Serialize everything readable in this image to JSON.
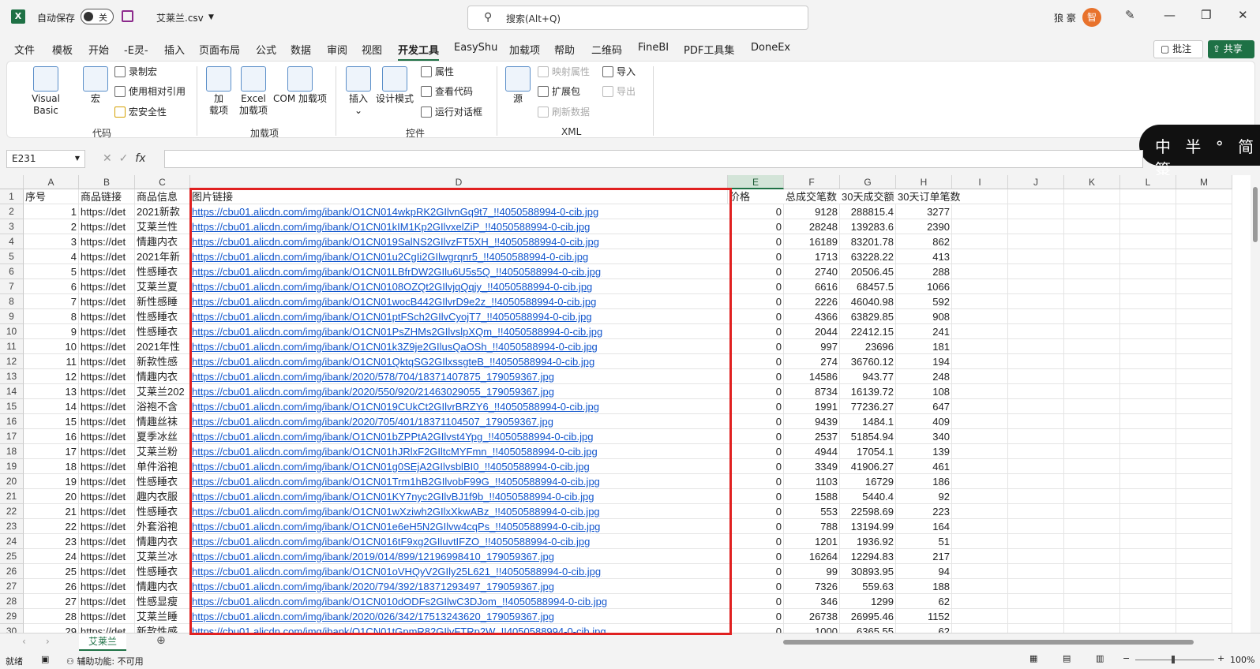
{
  "titlebar": {
    "autosave_label": "自动保存",
    "autosave_state": "关",
    "filename": "艾莱兰.csv",
    "search_placeholder": "搜索(Alt+Q)",
    "user_name": "狼 豪",
    "avatar_text": "智"
  },
  "menu": [
    "文件",
    "模板",
    "开始",
    "-E灵-",
    "插入",
    "页面布局",
    "公式",
    "数据",
    "审阅",
    "视图",
    "开发工具",
    "EasyShu",
    "加载项",
    "帮助",
    "二维码",
    "FineBI",
    "PDF工具集",
    "DoneEx"
  ],
  "menu_active": "开发工具",
  "actions": {
    "comment": "批注",
    "share": "共享"
  },
  "ribbon": {
    "code": {
      "label": "代码",
      "visual_basic": "Visual Basic",
      "macro": "宏",
      "record_macro": "录制宏",
      "relative_ref": "使用相对引用",
      "macro_security": "宏安全性"
    },
    "addins": {
      "label": "加载项",
      "add": "加\n载项",
      "excel_addins": "Excel\n加载项",
      "com_addins": "COM 加载项"
    },
    "controls": {
      "label": "控件",
      "insert": "插入",
      "design_mode": "设计模式",
      "properties": "属性",
      "view_code": "查看代码",
      "run_dialog": "运行对话框"
    },
    "xml": {
      "label": "XML",
      "source": "源",
      "map_properties": "映射属性",
      "expansion_packs": "扩展包",
      "refresh_data": "刷新数据",
      "import": "导入",
      "export": "导出"
    }
  },
  "watermark": "中 半 ° 简 箓",
  "formula_bar": {
    "name_box": "E231",
    "fx": "fx",
    "value": ""
  },
  "columns": [
    "A",
    "B",
    "C",
    "D",
    "E",
    "F",
    "G",
    "H",
    "I",
    "J",
    "K",
    "L",
    "M"
  ],
  "selected_column": "E",
  "headers": [
    "序号",
    "商品链接",
    "商品信息",
    "图片链接",
    "价格",
    "总成交笔数",
    "30天成交额",
    "30天订单笔数"
  ],
  "rows": [
    [
      "1",
      "https://det",
      "2021新款",
      "https://cbu01.alicdn.com/img/ibank/O1CN014wkpRK2GIlvnGq9t7_!!4050588994-0-cib.jpg",
      "0",
      "9128",
      "288815.4",
      "3277"
    ],
    [
      "2",
      "https://det",
      "艾莱兰性",
      "https://cbu01.alicdn.com/img/ibank/O1CN01kIM1Kp2GIlvxelZiP_!!4050588994-0-cib.jpg",
      "0",
      "28248",
      "139283.6",
      "2390"
    ],
    [
      "3",
      "https://det",
      "情趣内衣",
      "https://cbu01.alicdn.com/img/ibank/O1CN019SalNS2GIlvzFT5XH_!!4050588994-0-cib.jpg",
      "0",
      "16189",
      "83201.78",
      "862"
    ],
    [
      "4",
      "https://det",
      "2021年新",
      "https://cbu01.alicdn.com/img/ibank/O1CN01u2CgIi2GIlwgrqnr5_!!4050588994-0-cib.jpg",
      "0",
      "1713",
      "63228.22",
      "413"
    ],
    [
      "5",
      "https://det",
      "性感睡衣",
      "https://cbu01.alicdn.com/img/ibank/O1CN01LBfrDW2GIlu6U5s5Q_!!4050588994-0-cib.jpg",
      "0",
      "2740",
      "20506.45",
      "288"
    ],
    [
      "6",
      "https://det",
      "艾莱兰夏",
      "https://cbu01.alicdn.com/img/ibank/O1CN0108OZQt2GIlvjqQqjy_!!4050588994-0-cib.jpg",
      "0",
      "6616",
      "68457.5",
      "1066"
    ],
    [
      "7",
      "https://det",
      "新性感睡",
      "https://cbu01.alicdn.com/img/ibank/O1CN01wocB442GIlvrD9e2z_!!4050588994-0-cib.jpg",
      "0",
      "2226",
      "46040.98",
      "592"
    ],
    [
      "8",
      "https://det",
      "性感睡衣",
      "https://cbu01.alicdn.com/img/ibank/O1CN01ptFSch2GIlvCyojT7_!!4050588994-0-cib.jpg",
      "0",
      "4366",
      "63829.85",
      "908"
    ],
    [
      "9",
      "https://det",
      "性感睡衣",
      "https://cbu01.alicdn.com/img/ibank/O1CN01PsZHMs2GIlvslpXQm_!!4050588994-0-cib.jpg",
      "0",
      "2044",
      "22412.15",
      "241"
    ],
    [
      "10",
      "https://det",
      "2021年性",
      "https://cbu01.alicdn.com/img/ibank/O1CN01k3Z9je2GIlusQaOSh_!!4050588994-0-cib.jpg",
      "0",
      "997",
      "23696",
      "181"
    ],
    [
      "11",
      "https://det",
      "新款性感",
      "https://cbu01.alicdn.com/img/ibank/O1CN01QktqSG2GIlxssgteB_!!4050588994-0-cib.jpg",
      "0",
      "274",
      "36760.12",
      "194"
    ],
    [
      "12",
      "https://det",
      "情趣内衣",
      "https://cbu01.alicdn.com/img/ibank/2020/578/704/18371407875_179059367.jpg",
      "0",
      "14586",
      "943.77",
      "248"
    ],
    [
      "13",
      "https://det",
      "艾莱兰202",
      "https://cbu01.alicdn.com/img/ibank/2020/550/920/21463029055_179059367.jpg",
      "0",
      "8734",
      "16139.72",
      "108"
    ],
    [
      "14",
      "https://det",
      "浴袍不含",
      "https://cbu01.alicdn.com/img/ibank/O1CN019CUkCt2GIlvrBRZY6_!!4050588994-0-cib.jpg",
      "0",
      "1991",
      "77236.27",
      "647"
    ],
    [
      "15",
      "https://det",
      "情趣丝袜",
      "https://cbu01.alicdn.com/img/ibank/2020/705/401/18371104507_179059367.jpg",
      "0",
      "9439",
      "1484.1",
      "409"
    ],
    [
      "16",
      "https://det",
      "夏季冰丝",
      "https://cbu01.alicdn.com/img/ibank/O1CN01bZPPtA2GIlvst4Ypg_!!4050588994-0-cib.jpg",
      "0",
      "2537",
      "51854.94",
      "340"
    ],
    [
      "17",
      "https://det",
      "艾莱兰粉",
      "https://cbu01.alicdn.com/img/ibank/O1CN01hJRlxF2GIltcMYFmn_!!4050588994-0-cib.jpg",
      "0",
      "4944",
      "17054.1",
      "139"
    ],
    [
      "18",
      "https://det",
      "单件浴袍",
      "https://cbu01.alicdn.com/img/ibank/O1CN01g0SEjA2GIlvsblBI0_!!4050588994-0-cib.jpg",
      "0",
      "3349",
      "41906.27",
      "461"
    ],
    [
      "19",
      "https://det",
      "性感睡衣",
      "https://cbu01.alicdn.com/img/ibank/O1CN01Trm1hB2GIlvobF99G_!!4050588994-0-cib.jpg",
      "0",
      "1103",
      "16729",
      "186"
    ],
    [
      "20",
      "https://det",
      "趣内衣服",
      "https://cbu01.alicdn.com/img/ibank/O1CN01KY7nyc2GIlvBJ1f9b_!!4050588994-0-cib.jpg",
      "0",
      "1588",
      "5440.4",
      "92"
    ],
    [
      "21",
      "https://det",
      "性感睡衣",
      "https://cbu01.alicdn.com/img/ibank/O1CN01wXziwh2GIlxXkwABz_!!4050588994-0-cib.jpg",
      "0",
      "553",
      "22598.69",
      "223"
    ],
    [
      "22",
      "https://det",
      "外套浴袍",
      "https://cbu01.alicdn.com/img/ibank/O1CN01e6eH5N2GIlvw4cqPs_!!4050588994-0-cib.jpg",
      "0",
      "788",
      "13194.99",
      "164"
    ],
    [
      "23",
      "https://det",
      "情趣内衣",
      "https://cbu01.alicdn.com/img/ibank/O1CN016tF9xg2GIluvtIFZO_!!4050588994-0-cib.jpg",
      "0",
      "1201",
      "1936.92",
      "51"
    ],
    [
      "24",
      "https://det",
      "艾莱兰冰",
      "https://cbu01.alicdn.com/img/ibank/2019/014/899/12196998410_179059367.jpg",
      "0",
      "16264",
      "12294.83",
      "217"
    ],
    [
      "25",
      "https://det",
      "性感睡衣",
      "https://cbu01.alicdn.com/img/ibank/O1CN01oVHQyV2GIly25L621_!!4050588994-0-cib.jpg",
      "0",
      "99",
      "30893.95",
      "94"
    ],
    [
      "26",
      "https://det",
      "情趣内衣",
      "https://cbu01.alicdn.com/img/ibank/2020/794/392/18371293497_179059367.jpg",
      "0",
      "7326",
      "559.63",
      "188"
    ],
    [
      "27",
      "https://det",
      "性感显瘦",
      "https://cbu01.alicdn.com/img/ibank/O1CN010dODFs2GIlwC3DJom_!!4050588994-0-cib.jpg",
      "0",
      "346",
      "1299",
      "62"
    ],
    [
      "28",
      "https://det",
      "艾莱兰睡",
      "https://cbu01.alicdn.com/img/ibank/2020/026/342/17513243620_179059367.jpg",
      "0",
      "26738",
      "26995.46",
      "1152"
    ],
    [
      "29",
      "https://det",
      "新款性感",
      "https://cbu01.alicdn.com/img/ibank/O1CN01tGpmR82GIlvFTRp2W_!!4050588994-0-cib.jpg",
      "0",
      "1000",
      "6365.55",
      "62"
    ]
  ],
  "sheet_tab": "艾莱兰",
  "status": {
    "ready": "就绪",
    "accessibility": "辅助功能: 不可用",
    "zoom": "100%"
  }
}
